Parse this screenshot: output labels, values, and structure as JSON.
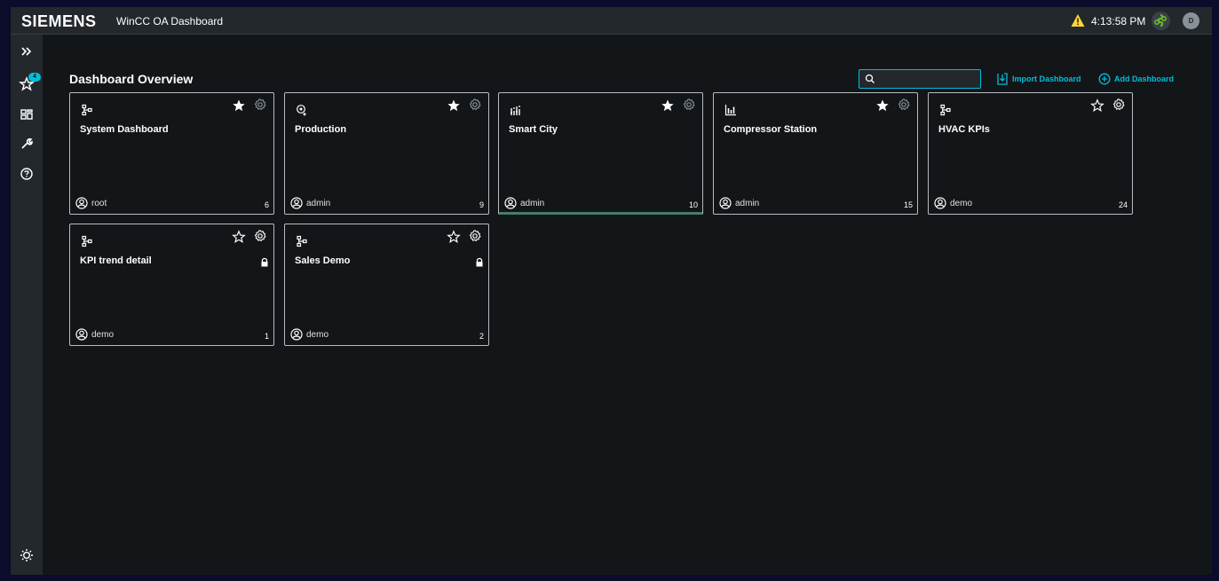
{
  "header": {
    "brand": "SIEMENS",
    "app_title": "WinCC OA Dashboard",
    "clock": "4:13:58 PM",
    "user_initial": "D",
    "warning_icon": "warning-triangle-icon",
    "colors": {
      "warning": "#ffd732",
      "status": "#6dbf2a",
      "accent": "#00bedc"
    }
  },
  "sidebar": {
    "items": [
      {
        "icon": "expand-chevrons-icon"
      },
      {
        "icon": "favorites-star-icon",
        "badge": "4"
      },
      {
        "icon": "dashboard-icon"
      },
      {
        "icon": "wrench-icon"
      },
      {
        "icon": "help-icon"
      },
      {
        "icon": "theme-sun-icon"
      }
    ]
  },
  "main": {
    "title": "Dashboard Overview",
    "search": {
      "value": "",
      "placeholder": ""
    },
    "import_label": "Import Dashboard",
    "add_label": "Add Dashboard"
  },
  "dashboards": [
    {
      "name": "System Dashboard",
      "owner": "root",
      "count": "6",
      "favorite": true,
      "icon": "hierarchy-icon",
      "locked": false
    },
    {
      "name": "Production",
      "owner": "admin",
      "count": "9",
      "favorite": true,
      "icon": "map-pin-icon",
      "locked": false
    },
    {
      "name": "Smart City",
      "owner": "admin",
      "count": "10",
      "favorite": true,
      "icon": "equalizer-icon",
      "locked": false,
      "selected": true
    },
    {
      "name": "Compressor Station",
      "owner": "admin",
      "count": "15",
      "favorite": true,
      "icon": "bar-chart-icon",
      "locked": false
    },
    {
      "name": "HVAC KPIs",
      "owner": "demo",
      "count": "24",
      "favorite": false,
      "icon": "hierarchy-icon",
      "locked": false
    },
    {
      "name": "KPI trend detail",
      "owner": "demo",
      "count": "1",
      "favorite": false,
      "icon": "hierarchy-icon",
      "locked": true
    },
    {
      "name": "Sales Demo",
      "owner": "demo",
      "count": "2",
      "favorite": false,
      "icon": "hierarchy-icon",
      "locked": true
    }
  ]
}
